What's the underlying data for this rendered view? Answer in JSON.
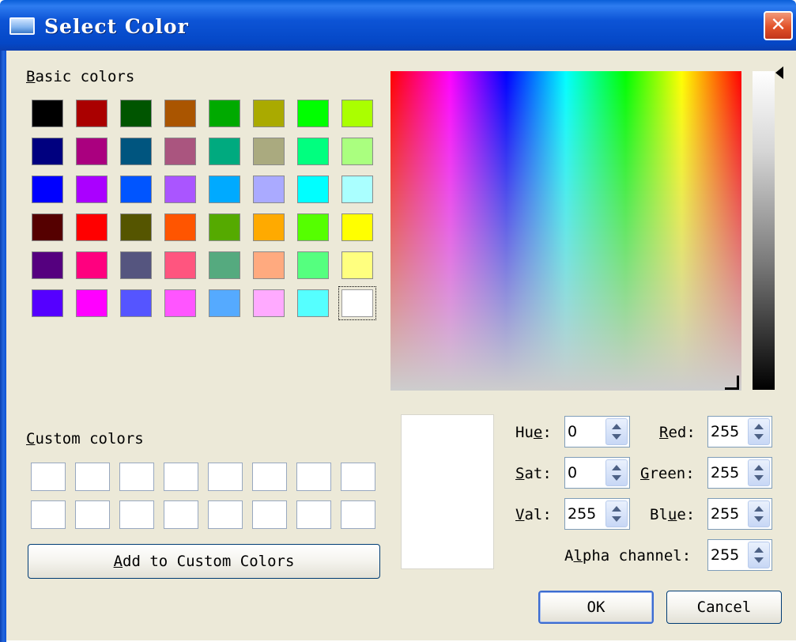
{
  "window": {
    "title": "Select Color",
    "close_glyph": "✕"
  },
  "basic_colors": {
    "label_hotkey": "B",
    "label_rest": "asic colors",
    "rows": [
      [
        "#000000",
        "#aa0000",
        "#005500",
        "#aa5500",
        "#00aa00",
        "#aaaa00",
        "#00ff00",
        "#aaff00"
      ],
      [
        "#00007f",
        "#aa007f",
        "#00557f",
        "#aa557f",
        "#00aa7f",
        "#aaaa7f",
        "#00ff7f",
        "#aaff7f"
      ],
      [
        "#0000ff",
        "#aa00ff",
        "#0055ff",
        "#aa55ff",
        "#00aaff",
        "#aaaaff",
        "#00ffff",
        "#aaffff"
      ],
      [
        "#550000",
        "#ff0000",
        "#555500",
        "#ff5500",
        "#55aa00",
        "#ffaa00",
        "#55ff00",
        "#ffff00"
      ],
      [
        "#55007f",
        "#ff007f",
        "#55557f",
        "#ff557f",
        "#55aa7f",
        "#ffaa7f",
        "#55ff7f",
        "#ffff7f"
      ],
      [
        "#5500ff",
        "#ff00ff",
        "#5555ff",
        "#ff55ff",
        "#55aaff",
        "#ffaaff",
        "#55ffff",
        "#ffffff"
      ]
    ],
    "selected": {
      "row": 5,
      "col": 7
    }
  },
  "custom_colors": {
    "label_hotkey": "C",
    "label_rest": "ustom colors",
    "rows": 2,
    "cols": 8
  },
  "add_button": {
    "hotkey": "A",
    "rest": "dd to Custom Colors"
  },
  "fields": {
    "hue": {
      "pre": "Hu",
      "hotkey": "e",
      "post": ":",
      "value": "0"
    },
    "sat": {
      "pre": "",
      "hotkey": "S",
      "post": "at:",
      "value": "0"
    },
    "val": {
      "pre": "",
      "hotkey": "V",
      "post": "al:",
      "value": "255"
    },
    "red": {
      "pre": "",
      "hotkey": "R",
      "post": "ed:",
      "value": "255"
    },
    "green": {
      "pre": "",
      "hotkey": "G",
      "post": "reen:",
      "value": "255"
    },
    "blue": {
      "pre": "Bl",
      "hotkey": "u",
      "post": "e:",
      "value": "255"
    },
    "alpha": {
      "pre": "A",
      "hotkey": "l",
      "post": "pha channel:",
      "value": "255"
    }
  },
  "preview_color": "#ffffff",
  "buttons": {
    "ok": "OK",
    "cancel": "Cancel"
  }
}
